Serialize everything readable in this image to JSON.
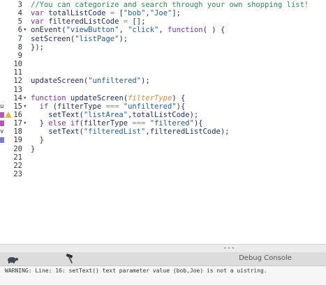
{
  "editor": {
    "lines": [
      {
        "num": "3",
        "fold": "",
        "tokens": [
          {
            "t": "cm",
            "v": "//You can categorize and search through your own shopping list!"
          }
        ]
      },
      {
        "num": "4",
        "fold": "",
        "tokens": [
          {
            "t": "kw",
            "v": "var "
          },
          {
            "t": "pl",
            "v": "totalListCode "
          },
          {
            "t": "op",
            "v": "= "
          },
          {
            "t": "pl",
            "v": "["
          },
          {
            "t": "str",
            "v": "\"bob\""
          },
          {
            "t": "pl",
            "v": ","
          },
          {
            "t": "str",
            "v": "\"Joe\""
          },
          {
            "t": "pl",
            "v": "];"
          }
        ]
      },
      {
        "num": "5",
        "fold": "",
        "tokens": [
          {
            "t": "kw",
            "v": "var "
          },
          {
            "t": "pl",
            "v": "filteredListCode "
          },
          {
            "t": "op",
            "v": "= "
          },
          {
            "t": "pl",
            "v": "[];"
          }
        ]
      },
      {
        "num": "6",
        "fold": "▾",
        "tokens": [
          {
            "t": "pl",
            "v": "onEvent("
          },
          {
            "t": "str",
            "v": "\"viewButton\""
          },
          {
            "t": "pl",
            "v": ", "
          },
          {
            "t": "str",
            "v": "\"click\""
          },
          {
            "t": "pl",
            "v": ", "
          },
          {
            "t": "kw",
            "v": "function"
          },
          {
            "t": "pl",
            "v": "( ) {"
          }
        ]
      },
      {
        "num": "7",
        "fold": "",
        "tokens": [
          {
            "t": "pl",
            "v": "setScreen("
          },
          {
            "t": "str",
            "v": "\"listPage\""
          },
          {
            "t": "pl",
            "v": ");"
          }
        ]
      },
      {
        "num": "8",
        "fold": "",
        "tokens": [
          {
            "t": "pl",
            "v": "});"
          }
        ]
      },
      {
        "num": "9",
        "fold": "",
        "tokens": []
      },
      {
        "num": "10",
        "fold": "",
        "tokens": []
      },
      {
        "num": "11",
        "fold": "",
        "tokens": []
      },
      {
        "num": "12",
        "fold": "",
        "tokens": [
          {
            "t": "pl",
            "v": "updateScreen("
          },
          {
            "t": "str",
            "v": "\"unfiltered\""
          },
          {
            "t": "pl",
            "v": ");"
          }
        ]
      },
      {
        "num": "13",
        "fold": "",
        "tokens": []
      },
      {
        "num": "14",
        "fold": "▾",
        "tokens": [
          {
            "t": "kw",
            "v": "function "
          },
          {
            "t": "pl",
            "v": "updateScreen("
          },
          {
            "t": "param",
            "v": "filterType"
          },
          {
            "t": "pl",
            "v": ") {"
          }
        ]
      },
      {
        "num": "15",
        "fold": "▾",
        "tokens": [
          {
            "t": "pl",
            "v": "  "
          },
          {
            "t": "kw",
            "v": "if "
          },
          {
            "t": "pl",
            "v": "(filterType "
          },
          {
            "t": "op",
            "v": "=== "
          },
          {
            "t": "str",
            "v": "\"unfiltered\""
          },
          {
            "t": "pl",
            "v": "){"
          }
        ]
      },
      {
        "num": "16",
        "fold": "",
        "tokens": [
          {
            "t": "pl",
            "v": "    setText("
          },
          {
            "t": "str",
            "v": "\"listArea\""
          },
          {
            "t": "pl",
            "v": ",totalListCode);"
          }
        ]
      },
      {
        "num": "17",
        "fold": "▾",
        "tokens": [
          {
            "t": "pl",
            "v": "  } "
          },
          {
            "t": "kw",
            "v": "else if"
          },
          {
            "t": "pl",
            "v": "(filterType "
          },
          {
            "t": "op",
            "v": "=== "
          },
          {
            "t": "str",
            "v": "\"filtered\""
          },
          {
            "t": "pl",
            "v": "){"
          }
        ]
      },
      {
        "num": "18",
        "fold": "",
        "tokens": [
          {
            "t": "pl",
            "v": "    setText("
          },
          {
            "t": "str",
            "v": "\"filteredList\""
          },
          {
            "t": "pl",
            "v": ",filteredListCode);"
          }
        ]
      },
      {
        "num": "19",
        "fold": "",
        "tokens": [
          {
            "t": "pl",
            "v": "  }"
          }
        ]
      },
      {
        "num": "20",
        "fold": "",
        "tokens": [
          {
            "t": "pl",
            "v": "}"
          }
        ]
      },
      {
        "num": "21",
        "fold": "",
        "tokens": []
      },
      {
        "num": "22",
        "fold": "",
        "tokens": []
      },
      {
        "num": "23",
        "fold": "",
        "tokens": []
      }
    ],
    "gutter_markers": [
      {
        "line": "15",
        "letter": "u",
        "color": "#b05ab0"
      },
      {
        "line": "16",
        "letter": "",
        "color": "#b05ab0",
        "warning": true
      },
      {
        "line": "17",
        "letter": "",
        "color": "#b05ab0"
      },
      {
        "line": "18",
        "letter": "v",
        "color": "#7a7ad0"
      },
      {
        "line": "19",
        "letter": "",
        "color": "#7a7ad0"
      }
    ]
  },
  "debug": {
    "title": "Debug Console",
    "message": "WARNING: Line: 16: setText() text parameter value (bob,Joe) is not a uistring."
  },
  "icons": {
    "turtle": "turtle-icon",
    "hammer": "hammer-icon",
    "warning": "warning-icon"
  }
}
